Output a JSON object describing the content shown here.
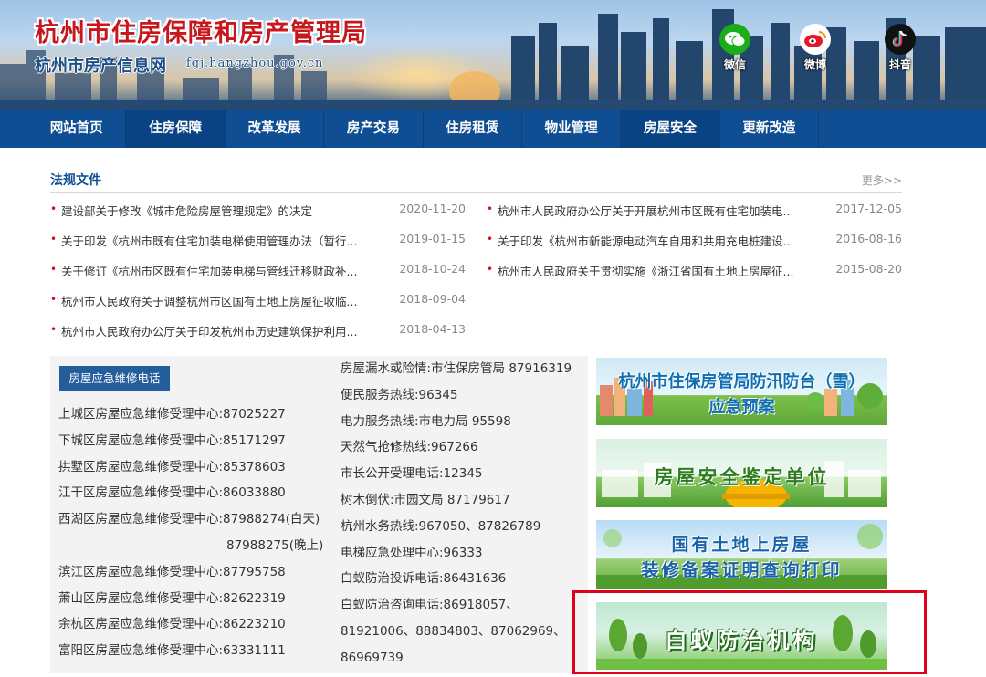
{
  "header": {
    "title": "杭州市住房保障和房产管理局",
    "subtitle": "杭州市房产信息网",
    "domain": "fgj.hangzhou.gov.cn",
    "social": [
      {
        "label": "微信",
        "icon": "wechat-icon",
        "color": "#1aad19"
      },
      {
        "label": "微博",
        "icon": "weibo-icon",
        "color": "#e6162d"
      },
      {
        "label": "抖音",
        "icon": "douyin-icon",
        "color": "#111111"
      }
    ]
  },
  "nav": {
    "items": [
      {
        "label": "网站首页"
      },
      {
        "label": "住房保障"
      },
      {
        "label": "改革发展"
      },
      {
        "label": "房产交易"
      },
      {
        "label": "住房租赁"
      },
      {
        "label": "物业管理"
      },
      {
        "label": "房屋安全"
      },
      {
        "label": "更新改造"
      }
    ],
    "bg_color": "#0f4e92"
  },
  "laws": {
    "title": "法规文件",
    "more": "更多>>",
    "left": [
      {
        "text": "建设部关于修改《城市危险房屋管理规定》的决定",
        "date": "2020-11-20"
      },
      {
        "text": "关于印发《杭州市既有住宅加装电梯使用管理办法（暂行...",
        "date": "2019-01-15"
      },
      {
        "text": "关于修订《杭州市区既有住宅加装电梯与管线迁移财政补...",
        "date": "2018-10-24"
      },
      {
        "text": "杭州市人民政府关于调整杭州市区国有土地上房屋征收临...",
        "date": "2018-09-04"
      },
      {
        "text": "杭州市人民政府办公厅关于印发杭州市历史建筑保护利用...",
        "date": "2018-04-13"
      }
    ],
    "right": [
      {
        "text": "杭州市人民政府办公厅关于开展杭州市区既有住宅加装电...",
        "date": "2017-12-05"
      },
      {
        "text": "关于印发《杭州市新能源电动汽车自用和共用充电桩建设...",
        "date": "2016-08-16"
      },
      {
        "text": "杭州市人民政府关于贯彻实施《浙江省国有土地上房屋征...",
        "date": "2015-08-20"
      }
    ]
  },
  "hotline": {
    "button": "房屋应急维修电话",
    "left": [
      "上城区房屋应急维修受理中心:87025227",
      "下城区房屋应急维修受理中心:85171297",
      "拱墅区房屋应急维修受理中心:85378603",
      "江干区房屋应急维修受理中心:86033880",
      "西湖区房屋应急维修受理中心:87988274(白天)",
      "87988275(晚上)",
      "滨江区房屋应急维修受理中心:87795758",
      "萧山区房屋应急维修受理中心:82622319",
      "余杭区房屋应急维修受理中心:86223210",
      "富阳区房屋应急维修受理中心:63331111"
    ],
    "right": [
      "房屋漏水或险情:市住保房管局 87916319",
      "便民服务热线:96345",
      "电力服务热线:市电力局 95598",
      "天然气抢修热线:967266",
      "市长公开受理电话:12345",
      "树木倒伏:市园文局 87179617",
      "杭州水务热线:967050、87826789",
      "电梯应急处理中心:96333",
      "白蚁防治投诉电话:86431636",
      "白蚁防治咨询电话:86918057、",
      "81921006、88834803、87062969、",
      "86969739"
    ]
  },
  "banners": [
    {
      "line1": "杭州市住保房管局防汛防台（雪）",
      "line2": "应急预案"
    },
    {
      "line1": "房屋安全鉴定单位"
    },
    {
      "line1": "国有土地上房屋",
      "line2": "装修备案证明查询打印"
    },
    {
      "line1": "白蚁防治机构"
    }
  ],
  "highlight_color": "#e0001b"
}
